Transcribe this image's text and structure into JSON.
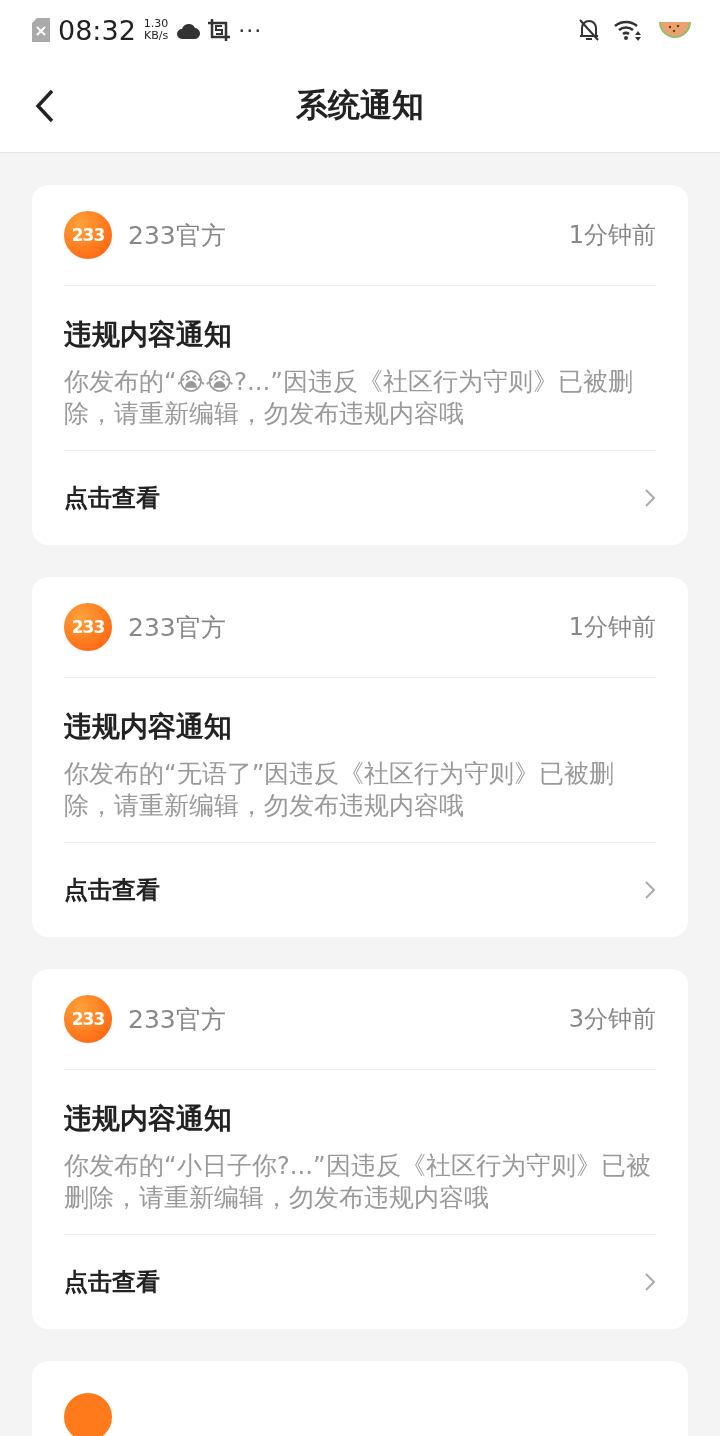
{
  "status_bar": {
    "time": "08:32",
    "speed_value": "1.30",
    "speed_unit": "KB/s",
    "more": "···"
  },
  "header": {
    "title": "系统通知"
  },
  "cards": [
    {
      "kind": "full",
      "logo": "233",
      "sender": "233官方",
      "time": "1分钟前",
      "title": "违规内容通知",
      "body": "你发布的“😭😭?...”因违反《社区行为守则》已被删除，请重新编辑，勿发布违规内容哦",
      "action": "点击查看"
    },
    {
      "kind": "full",
      "logo": "233",
      "sender": "233官方",
      "time": "1分钟前",
      "title": "违规内容通知",
      "body": "你发布的“无语了”因违反《社区行为守则》已被删除，请重新编辑，勿发布违规内容哦",
      "action": "点击查看"
    },
    {
      "kind": "full",
      "logo": "233",
      "sender": "233官方",
      "time": "3分钟前",
      "title": "违规内容通知",
      "body": "你发布的“小日子你?...”因违反《社区行为守则》已被删除，请重新编辑，勿发布违规内容哦",
      "action": "点击查看"
    },
    {
      "kind": "cut"
    }
  ]
}
